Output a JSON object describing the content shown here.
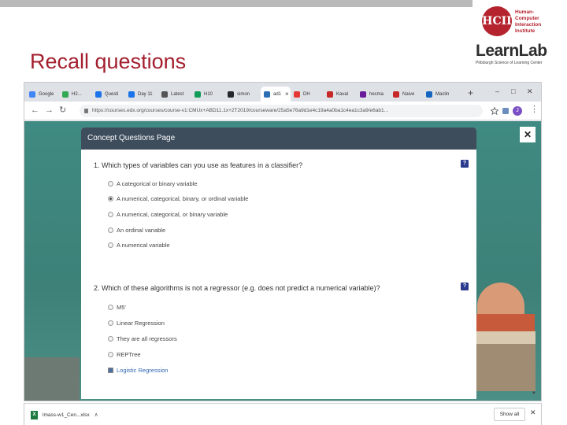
{
  "slide": {
    "title": "Recall questions",
    "hcii_monogram": "HCII",
    "hcii_lines": [
      "Human-",
      "Computer",
      "Interaction",
      "Institute"
    ],
    "learnlab_name": "LearnLab",
    "learnlab_tagline": "Pittsburgh Science of Learning Center"
  },
  "browser": {
    "tabs": [
      {
        "label": "Google",
        "color": "#4285f4"
      },
      {
        "label": "H2...",
        "color": "#34a853"
      },
      {
        "label": "Questi",
        "color": "#1a73e8"
      },
      {
        "label": "Day 11",
        "color": "#1a73e8"
      },
      {
        "label": "Latest",
        "color": "#555555"
      },
      {
        "label": "H10",
        "color": "#0f9d58"
      },
      {
        "label": "simon",
        "color": "#24292e"
      },
      {
        "label": "ad1",
        "color": "#2c6fb7",
        "active": true
      },
      {
        "label": "DH",
        "color": "#e53935"
      },
      {
        "label": "Kaval",
        "color": "#c62828"
      },
      {
        "label": "hecma",
        "color": "#6a1b9a"
      },
      {
        "label": "Naive",
        "color": "#c62828"
      },
      {
        "label": "Maclin",
        "color": "#1565c0"
      }
    ],
    "address": "https://courses.edx.org/courses/course-v1:CMUx+ABD11.1x+2T2019/courseware/25a5e76a9d1e4c19a4a0ba1c4ea1c3a9/e6ab1...",
    "profile_initial": "J"
  },
  "modal": {
    "title": "Concept Questions Page",
    "help_glyph": "?",
    "questions": [
      {
        "text": "1. Which types of variables can you use as features in a classifier?",
        "options": [
          {
            "label": "A categorical or binary variable",
            "checked": false
          },
          {
            "label": "A numerical, categorical, binary, or ordinal variable",
            "checked": true
          },
          {
            "label": "A numerical, categorical, or binary variable",
            "checked": false
          },
          {
            "label": "An ordinal variable",
            "checked": false
          },
          {
            "label": "A numerical variable",
            "checked": false
          }
        ]
      },
      {
        "text": "2. Which of these algorithms is not a regressor (e.g. does not predict a numerical variable)?",
        "options": [
          {
            "label": "M5'",
            "checked": false
          },
          {
            "label": "Linear Regression",
            "checked": false
          },
          {
            "label": "They are all regressors",
            "checked": false
          },
          {
            "label": "REPTree",
            "checked": false
          },
          {
            "label": "Logistic Regression",
            "checked": true
          }
        ]
      }
    ]
  },
  "download_bar": {
    "filename": "lmass-w1_Cen...xlsx",
    "file_badge": "X",
    "show_all": "Show all"
  }
}
